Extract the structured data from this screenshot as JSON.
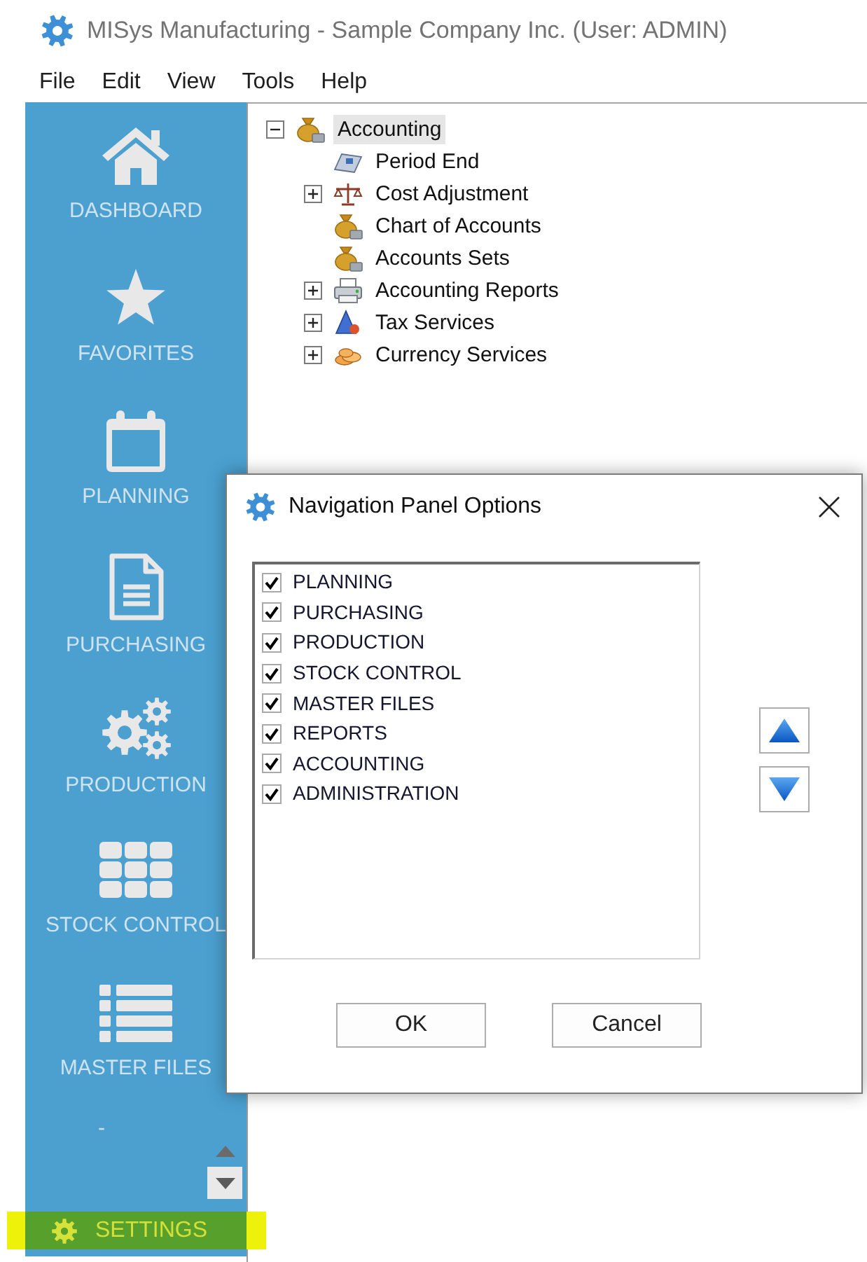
{
  "window": {
    "title": "MISys Manufacturing - Sample Company Inc. (User: ADMIN)"
  },
  "menu": [
    "File",
    "Edit",
    "View",
    "Tools",
    "Help"
  ],
  "sidebar": {
    "items": [
      {
        "label": "DASHBOARD"
      },
      {
        "label": "FAVORITES"
      },
      {
        "label": "PLANNING"
      },
      {
        "label": "PURCHASING"
      },
      {
        "label": "PRODUCTION"
      },
      {
        "label": "STOCK CONTROL"
      },
      {
        "label": "MASTER FILES"
      }
    ],
    "overflow_label": "-",
    "settings": {
      "label": "SETTINGS",
      "highlighted": true
    }
  },
  "tree": [
    {
      "label": "Accounting",
      "selected": true,
      "expanded": true,
      "children": [
        {
          "label": "Period End",
          "expandable": false
        },
        {
          "label": "Cost Adjustment",
          "expandable": true
        },
        {
          "label": "Chart of Accounts",
          "expandable": false
        },
        {
          "label": "Accounts Sets",
          "expandable": false
        },
        {
          "label": "Accounting Reports",
          "expandable": true
        },
        {
          "label": "Tax Services",
          "expandable": true
        },
        {
          "label": "Currency Services",
          "expandable": true
        }
      ]
    }
  ],
  "dialog": {
    "title": "Navigation Panel Options",
    "options": [
      {
        "label": "PLANNING",
        "checked": true
      },
      {
        "label": "PURCHASING",
        "checked": true
      },
      {
        "label": "PRODUCTION",
        "checked": true
      },
      {
        "label": "STOCK CONTROL",
        "checked": true
      },
      {
        "label": "MASTER FILES",
        "checked": true
      },
      {
        "label": "REPORTS",
        "checked": true
      },
      {
        "label": "ACCOUNTING",
        "checked": true
      },
      {
        "label": "ADMINISTRATION",
        "checked": true
      }
    ],
    "buttons": [
      "OK",
      "Cancel"
    ]
  }
}
